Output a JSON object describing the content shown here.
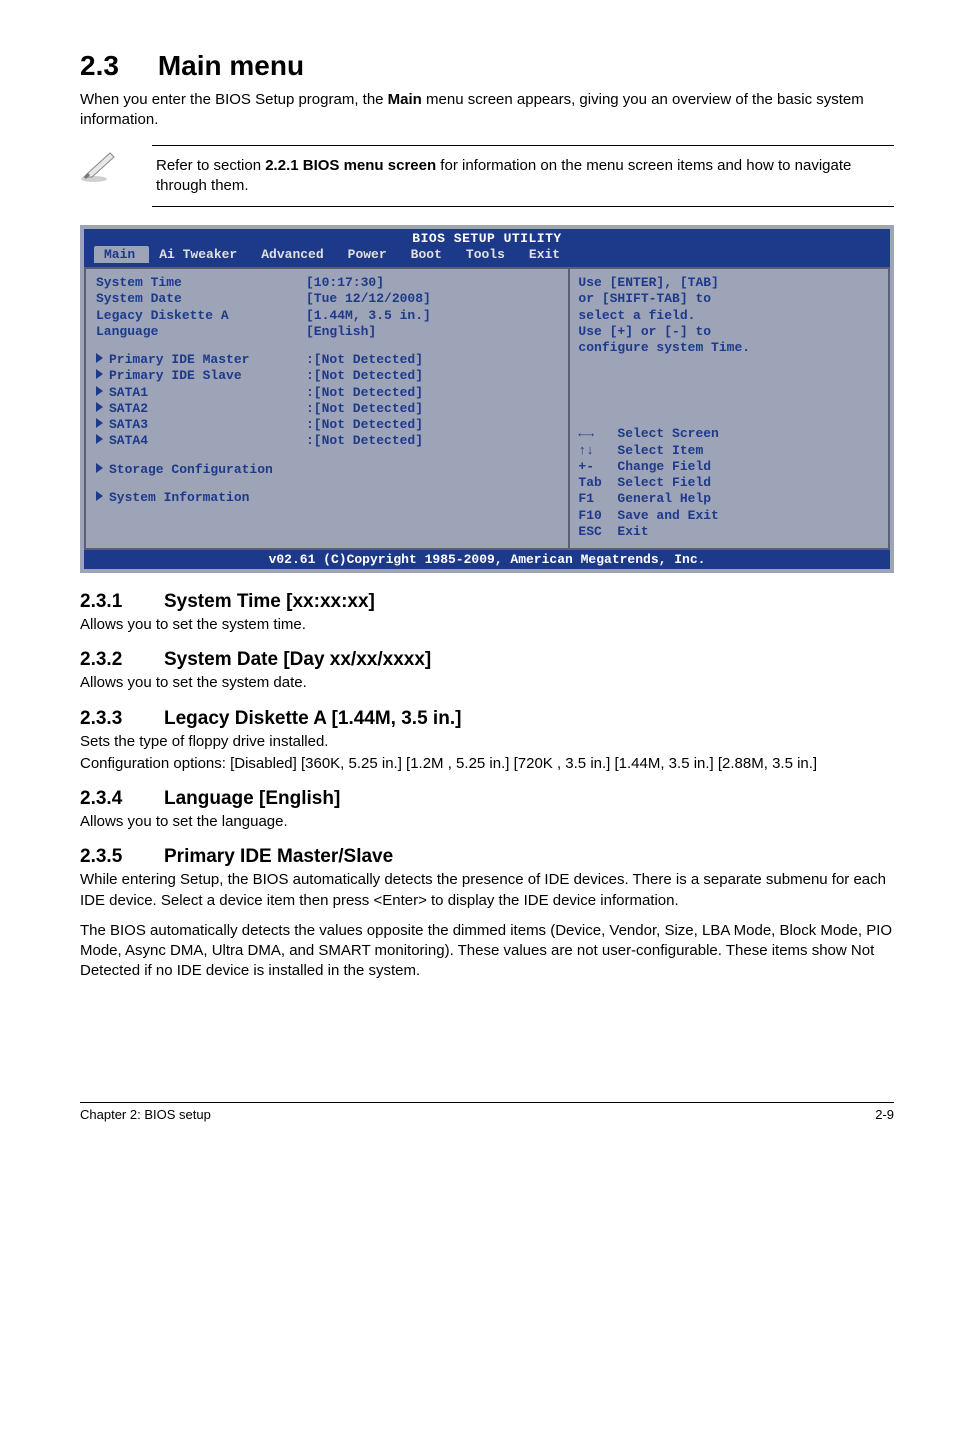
{
  "header": {
    "number": "2.3",
    "title": "Main menu"
  },
  "intro_prefix": "When you enter the BIOS Setup program, the ",
  "intro_bold": "Main",
  "intro_suffix": " menu screen appears, giving you an overview of the basic system information.",
  "note_prefix": "Refer to section ",
  "note_bold": "2.2.1 BIOS menu screen",
  "note_suffix": " for information on the menu screen items and how to navigate through them.",
  "bios": {
    "title": "BIOS SETUP UTILITY",
    "tabs": [
      "Main",
      "Ai Tweaker",
      "Advanced",
      "Power",
      "Boot",
      "Tools",
      "Exit"
    ],
    "selected_tab": "Main",
    "items": [
      {
        "label": "System Time",
        "value": "[10:17:30]",
        "arrow": false
      },
      {
        "label": "System Date",
        "value": "[Tue 12/12/2008]",
        "arrow": false
      },
      {
        "label": "Legacy Diskette A",
        "value": "[1.44M, 3.5 in.]",
        "arrow": false
      },
      {
        "label": "Language",
        "value": "[English]",
        "arrow": false
      }
    ],
    "detect_items": [
      {
        "label": "Primary IDE Master",
        "value": ":[Not Detected]"
      },
      {
        "label": "Primary IDE Slave",
        "value": ":[Not Detected]"
      },
      {
        "label": "SATA1",
        "value": ":[Not Detected]"
      },
      {
        "label": "SATA2",
        "value": ":[Not Detected]"
      },
      {
        "label": "SATA3",
        "value": ":[Not Detected]"
      },
      {
        "label": "SATA4",
        "value": ":[Not Detected]"
      }
    ],
    "extra_items": [
      "Storage Configuration",
      "System Information"
    ],
    "help_upper": [
      "Use [ENTER], [TAB]",
      "or [SHIFT-TAB] to",
      "select a field.",
      "",
      "Use [+] or [-] to",
      "configure system Time."
    ],
    "help_lower": [
      "←→   Select Screen",
      "↑↓   Select Item",
      "+-   Change Field",
      "Tab  Select Field",
      "F1   General Help",
      "F10  Save and Exit",
      "ESC  Exit"
    ],
    "footer": "v02.61 (C)Copyright 1985-2009, American Megatrends, Inc."
  },
  "subs": {
    "s1": {
      "num": "2.3.1",
      "title": "System Time [xx:xx:xx]",
      "body": "Allows you to set the system time."
    },
    "s2": {
      "num": "2.3.2",
      "title": "System Date [Day xx/xx/xxxx]",
      "body": "Allows you to set the system date."
    },
    "s3": {
      "num": "2.3.3",
      "title": "Legacy Diskette A [1.44M, 3.5 in.]",
      "body1": "Sets the type of floppy drive installed.",
      "body2": "Configuration options: [Disabled] [360K, 5.25 in.] [1.2M , 5.25 in.] [720K , 3.5 in.] [1.44M, 3.5 in.] [2.88M, 3.5 in.]"
    },
    "s4": {
      "num": "2.3.4",
      "title": "Language [English]",
      "body": "Allows you to set the language."
    },
    "s5": {
      "num": "2.3.5",
      "title": "Primary IDE Master/Slave",
      "body1": "While entering Setup, the BIOS automatically detects the presence of IDE devices. There is a separate submenu for each IDE device. Select a device item then press <Enter> to display the IDE device information.",
      "body2": "The BIOS automatically detects the values opposite the dimmed items (Device, Vendor, Size, LBA Mode, Block Mode, PIO Mode, Async DMA, Ultra DMA, and SMART monitoring). These values are not user-configurable. These items show Not Detected if no IDE device is installed in the system."
    }
  },
  "footer": {
    "left": "Chapter 2: BIOS setup",
    "right": "2-9"
  }
}
